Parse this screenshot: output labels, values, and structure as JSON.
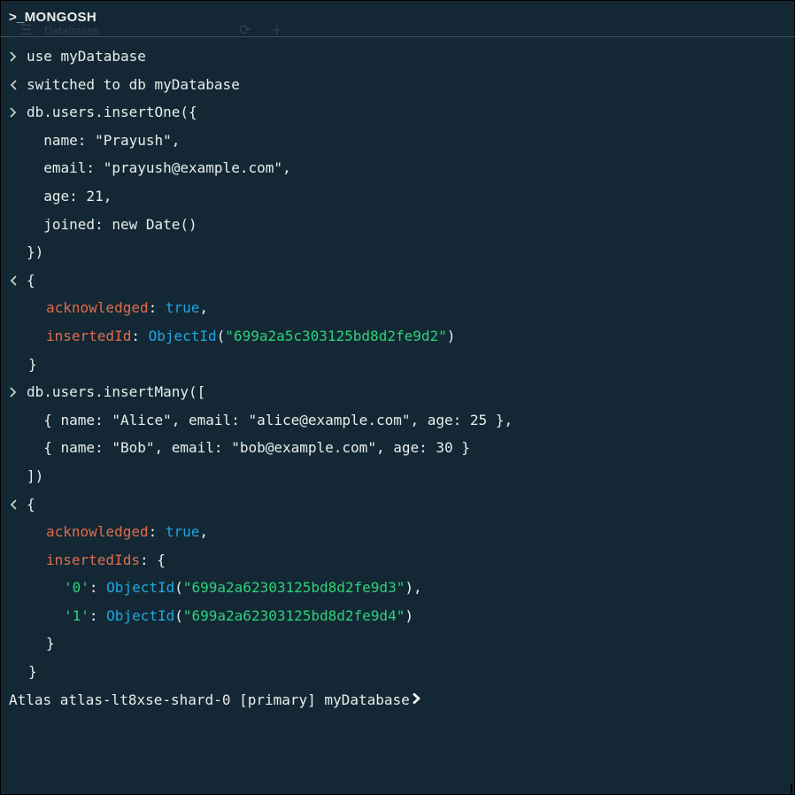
{
  "header": {
    "brand": ">_MONGOSH",
    "ghost_label": "Databases"
  },
  "icons": {
    "input": "chevron-right-icon",
    "output": "chevron-left-icon"
  },
  "colors": {
    "background": "#132834",
    "text": "#e8edeb",
    "key": "#e06c4b",
    "keyword": "#1ea7e0",
    "string": "#2ed17a"
  },
  "console": {
    "l0": "use myDatabase",
    "l1": "switched to db myDatabase",
    "l2": "db.users.insertOne({",
    "l3": "  name: \"Prayush\",",
    "l4": "  email: \"prayush@example.com\",",
    "l5": "  age: 21,",
    "l6": "  joined: new Date()",
    "l7": "})",
    "l8": "{",
    "l9_key": "acknowledged",
    "l9_sep": ": ",
    "l9_val": "true",
    "l9_end": ",",
    "l10_key": "insertedId",
    "l10_sep": ": ",
    "l10_fn": "ObjectId",
    "l10_open": "(",
    "l10_str": "\"699a2a5c303125bd8d2fe9d2\"",
    "l10_close": ")",
    "l11": "}",
    "l12": "db.users.insertMany([",
    "l13": "  { name: \"Alice\", email: \"alice@example.com\", age: 25 },",
    "l14": "  { name: \"Bob\", email: \"bob@example.com\", age: 30 }",
    "l15": "])",
    "l16": "{",
    "l17_key": "acknowledged",
    "l17_sep": ": ",
    "l17_val": "true",
    "l17_end": ",",
    "l18_key": "insertedIds",
    "l18_rest": ": {",
    "l19_key": "'0'",
    "l19_sep": ": ",
    "l19_fn": "ObjectId",
    "l19_open": "(",
    "l19_str": "\"699a2a62303125bd8d2fe9d3\"",
    "l19_close": "),",
    "l20_key": "'1'",
    "l20_sep": ": ",
    "l20_fn": "ObjectId",
    "l20_open": "(",
    "l20_str": "\"699a2a62303125bd8d2fe9d4\"",
    "l20_close": ")",
    "l21": "}",
    "l22": "}",
    "prompt": "Atlas atlas-lt8xse-shard-0 [primary] myDatabase"
  }
}
